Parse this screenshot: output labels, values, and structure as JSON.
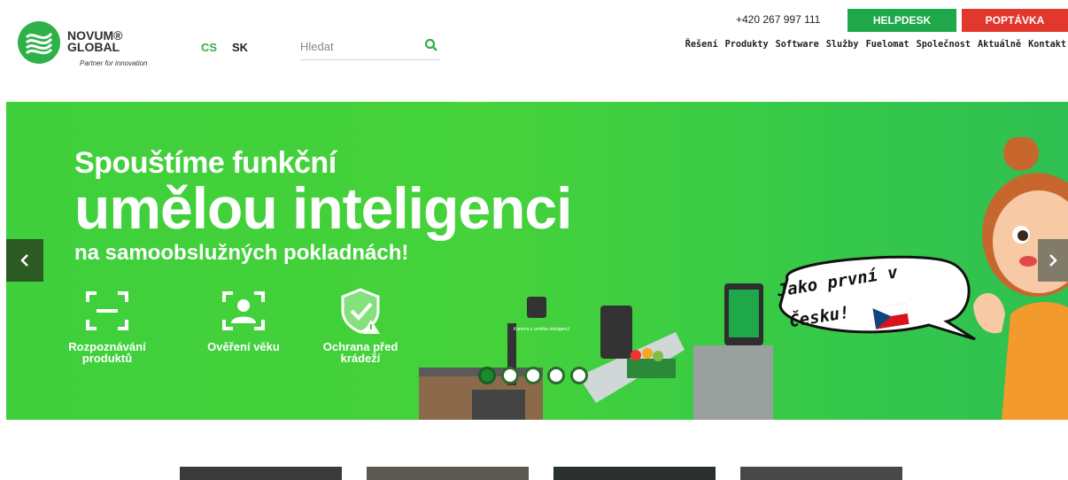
{
  "header": {
    "logo": {
      "line1": "NOVUM®",
      "line2": "GLOBAL",
      "tagline": "Partner for innovation"
    },
    "languages": [
      "CS",
      "SK"
    ],
    "search_placeholder": "Hledat",
    "phone": "+420 267 997 111",
    "helpdesk_label": "HELPDESK",
    "inquiry_label": "POPTÁVKA",
    "nav": [
      "Řešení",
      "Produkty",
      "Software",
      "Služby",
      "Fuelomat",
      "Společnost",
      "Aktuálně",
      "Kontakt"
    ]
  },
  "hero": {
    "line1": "Spouštíme funkční",
    "line2": "umělou inteligenci",
    "line3": "na samoobslužných pokladnách!",
    "features": [
      {
        "label_1": "Rozpoznávání",
        "label_2": "produktů",
        "icon": "scan-icon"
      },
      {
        "label_1": "Ověření věku",
        "label_2": "",
        "icon": "face-id-icon"
      },
      {
        "label_1": "Ochrana před",
        "label_2": "krádeží",
        "icon": "shield-icon"
      }
    ],
    "bubble_line1": "Jako první v",
    "bubble_line2": "Česku!",
    "kiosk_caption": "Kamera s umělou inteligencí",
    "slides_total": 5,
    "active_slide": 1
  },
  "colors": {
    "brand_green": "#2fb14a",
    "helpdesk": "#1fa84a",
    "inquiry": "#e2372d",
    "hero_bg": "#45d23a"
  }
}
